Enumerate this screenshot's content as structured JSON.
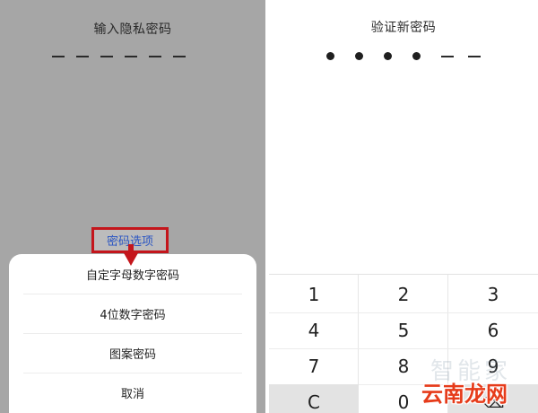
{
  "left_screen": {
    "title": "输入隐私密码",
    "dash_count": 6,
    "password_options_label": "密码选项",
    "sheet": {
      "items": [
        {
          "label": "自定字母数字密码"
        },
        {
          "label": "4位数字密码"
        },
        {
          "label": "图案密码"
        },
        {
          "label": "取消"
        }
      ]
    }
  },
  "right_screen": {
    "title": "验证新密码",
    "pin": {
      "filled": 4,
      "empty": 2
    },
    "keys": {
      "k1": "1",
      "k2": "2",
      "k3": "3",
      "k4": "4",
      "k5": "5",
      "k6": "6",
      "k7": "7",
      "k8": "8",
      "k9": "9",
      "clear": "C",
      "k0": "0",
      "backspace_icon": "⌫"
    }
  },
  "watermark": {
    "text": "云南龙网",
    "faint_text": "智能家"
  },
  "colors": {
    "highlight_red": "#c4161c",
    "link_blue": "#2a55c2",
    "watermark_orange": "#e63b1a",
    "overlay_gray": "#a6a6a6"
  }
}
